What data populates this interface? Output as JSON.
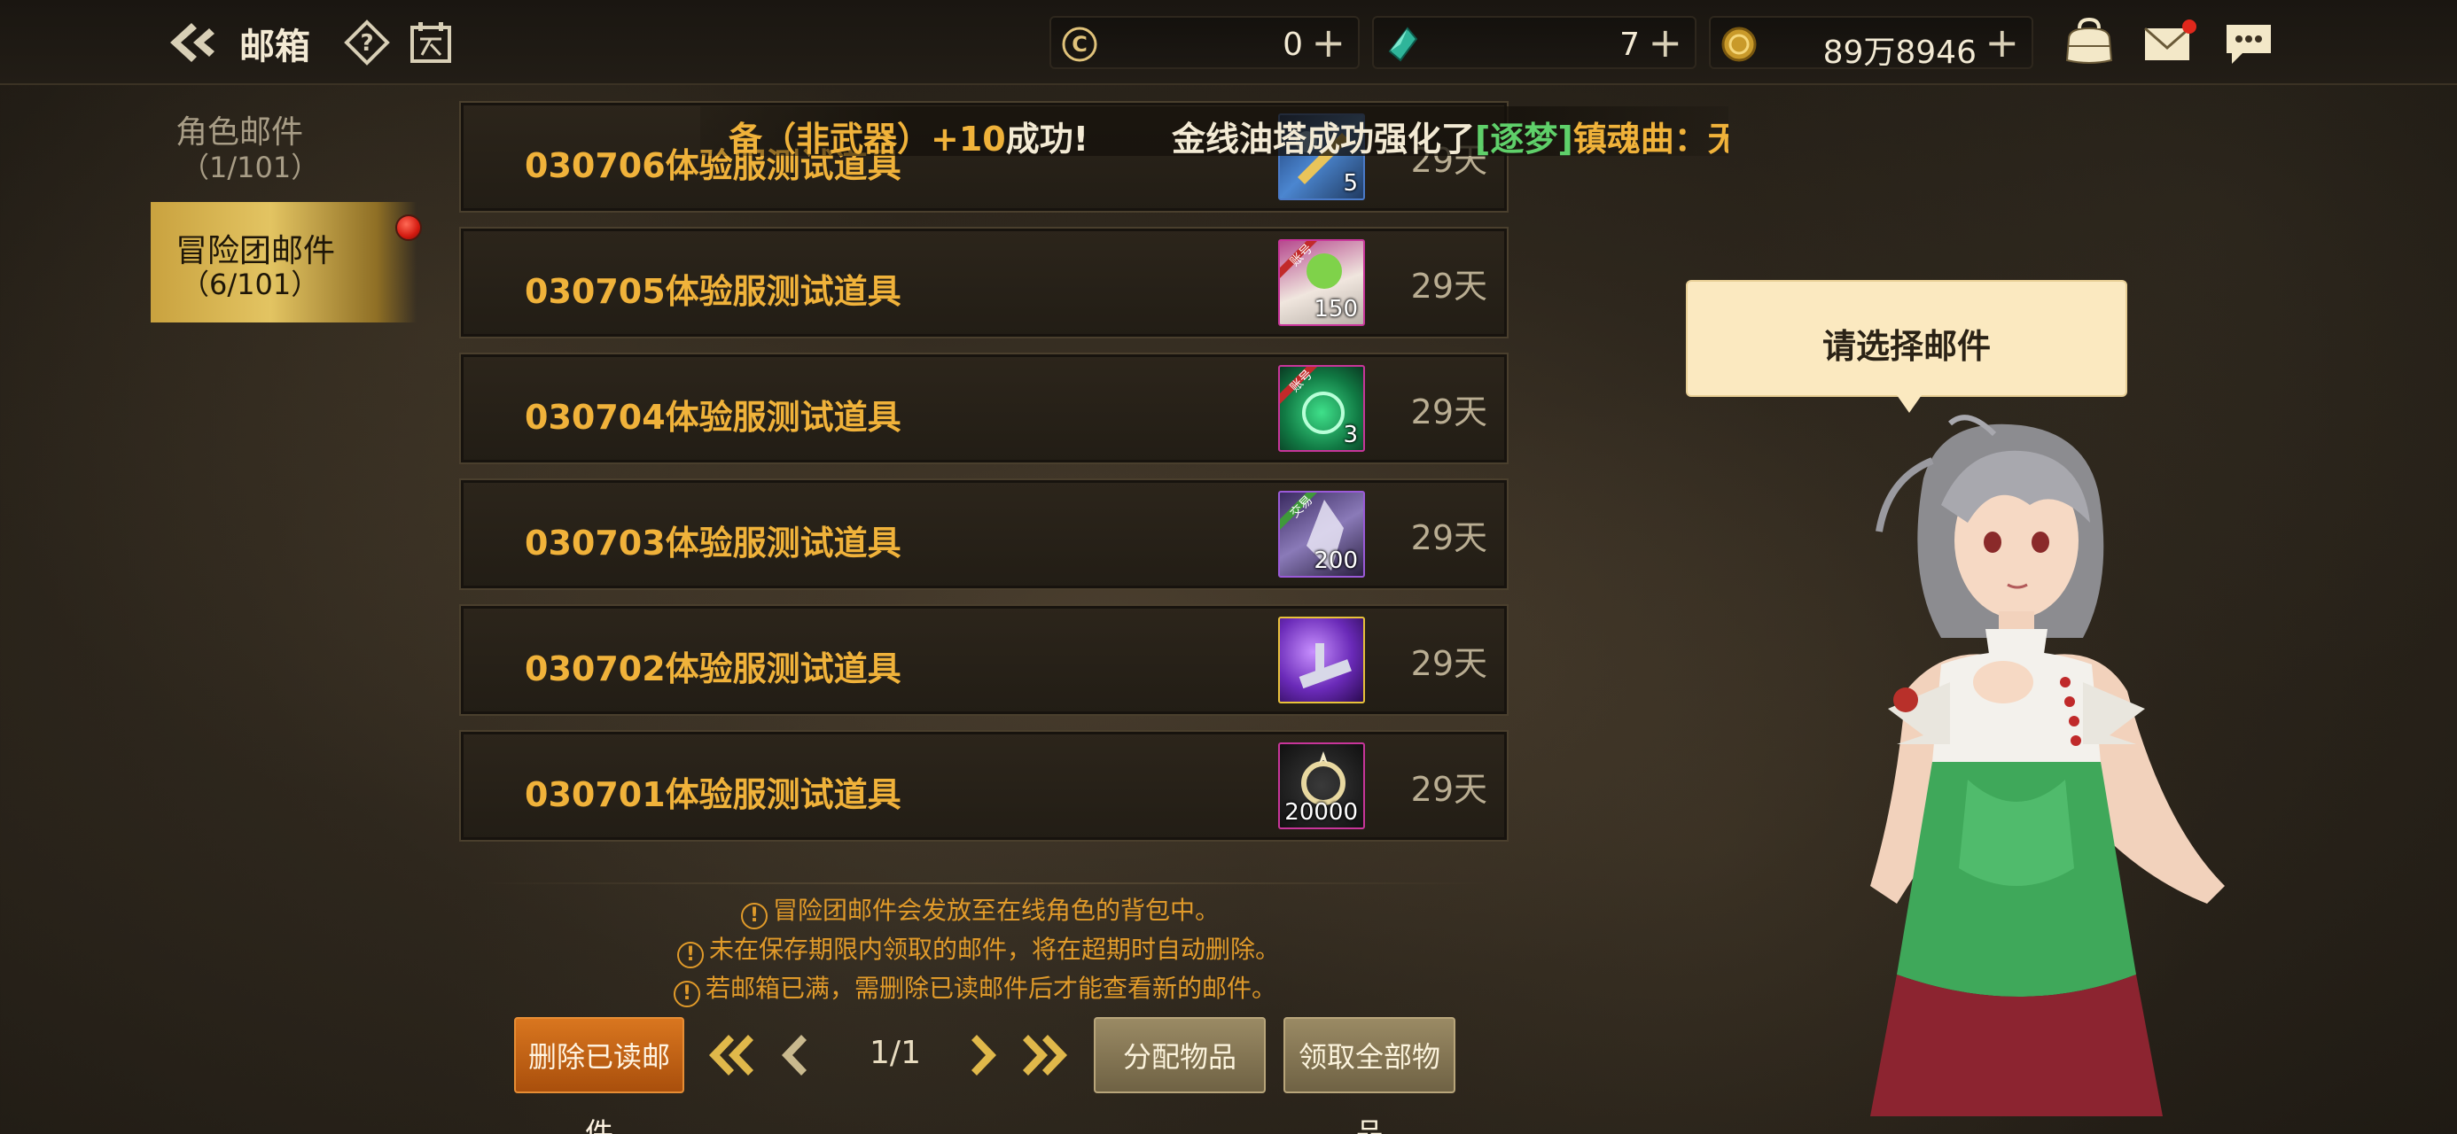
{
  "header": {
    "title": "邮箱",
    "currencies": [
      {
        "icon": "cera-coin-icon",
        "value": "0"
      },
      {
        "icon": "crystal-icon",
        "value": "7"
      },
      {
        "icon": "gold-coin-icon",
        "value": "89万8946"
      }
    ],
    "plus_label": "+"
  },
  "tabs": [
    {
      "label": "角色邮件",
      "count": "（1/101）",
      "selected": false
    },
    {
      "label": "冒险团邮件",
      "count": "（6/101）",
      "selected": true
    }
  ],
  "broadcast": {
    "part1_orange": "备（非武器）+10",
    "part1_white": "成功!",
    "part2_white": "金线油塔成功强化了",
    "part2_green": "[逐梦]",
    "part2_orange": "镇魂曲：无尽"
  },
  "mails": [
    {
      "title": "030706体验服测试道具",
      "days": "29天",
      "qty": "5",
      "item": "weapon-box-icon"
    },
    {
      "title": "030705体验服测试道具",
      "days": "29天",
      "qty": "150",
      "item": "potion-bundle-icon",
      "tag": "账号"
    },
    {
      "title": "030704体验服测试道具",
      "days": "29天",
      "qty": "3",
      "item": "green-orb-icon",
      "tag": "账号"
    },
    {
      "title": "030703体验服测试道具",
      "days": "29天",
      "qty": "200",
      "item": "crystal-shard-icon",
      "tag": "交易"
    },
    {
      "title": "030702体验服测试道具",
      "days": "29天",
      "qty": "",
      "item": "purple-gear-icon"
    },
    {
      "title": "030701体验服测试道具",
      "days": "29天",
      "qty": "20000",
      "item": "cera-coin-icon"
    }
  ],
  "notes": [
    "冒险团邮件会发放至在线角色的背包中。",
    "未在保存期限内领取的邮件，将在超期时自动删除。",
    "若邮箱已满，需删除已读邮件后才能查看新的邮件。"
  ],
  "footer": {
    "delete_read": "删除已读邮件",
    "page": "1/1",
    "assign": "分配物品",
    "claim_all": "领取全部物品"
  },
  "bubble": {
    "text": "请选择邮件"
  },
  "colors": {
    "accent_gold": "#f0b23a",
    "tab_gold": "#e3c462",
    "delete_orange": "#d9761f"
  }
}
